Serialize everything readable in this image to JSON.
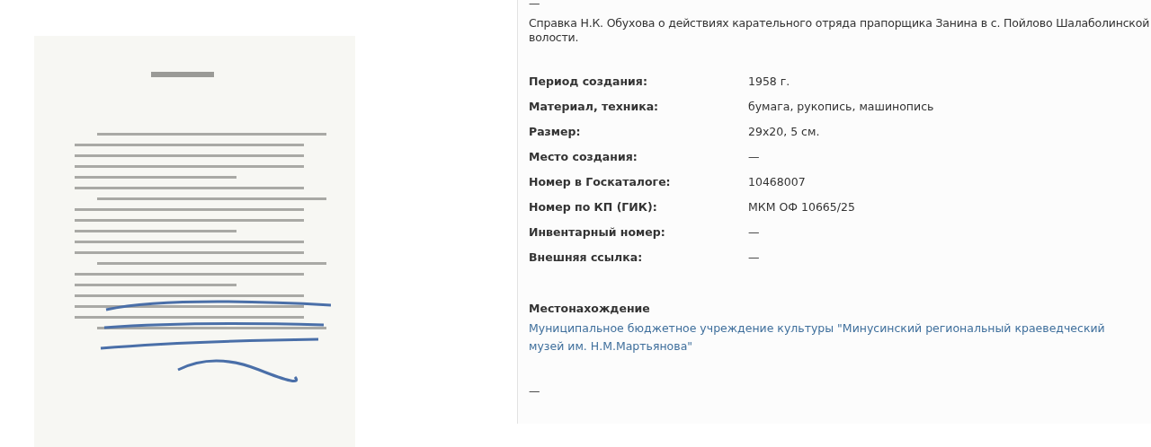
{
  "top_dash": "—",
  "description": "Справка Н.К. Обухова о действиях карательного отряда прапорщика Занина в с. Пойлово Шалаболинской волости.",
  "properties": [
    {
      "label": "Период создания:",
      "value": "1958 г."
    },
    {
      "label": "Материал, техника:",
      "value": "бумага, рукопись, машинопись"
    },
    {
      "label": "Размер:",
      "value": "29x20, 5 см."
    },
    {
      "label": "Место создания:",
      "value": "—"
    },
    {
      "label": "Номер в Госкаталоге:",
      "value": "10468007"
    },
    {
      "label": "Номер по КП (ГИК):",
      "value": "МКМ ОФ 10665/25"
    },
    {
      "label": "Инвентарный номер:",
      "value": "—"
    },
    {
      "label": "Внешняя ссылка:",
      "value": "—"
    }
  ],
  "location": {
    "heading": "Местонахождение",
    "link": "Муниципальное бюджетное учреждение культуры \"Минусинский региональный краеведческий музей им. Н.М.Мартьянова\""
  },
  "bottom_dash": "—"
}
